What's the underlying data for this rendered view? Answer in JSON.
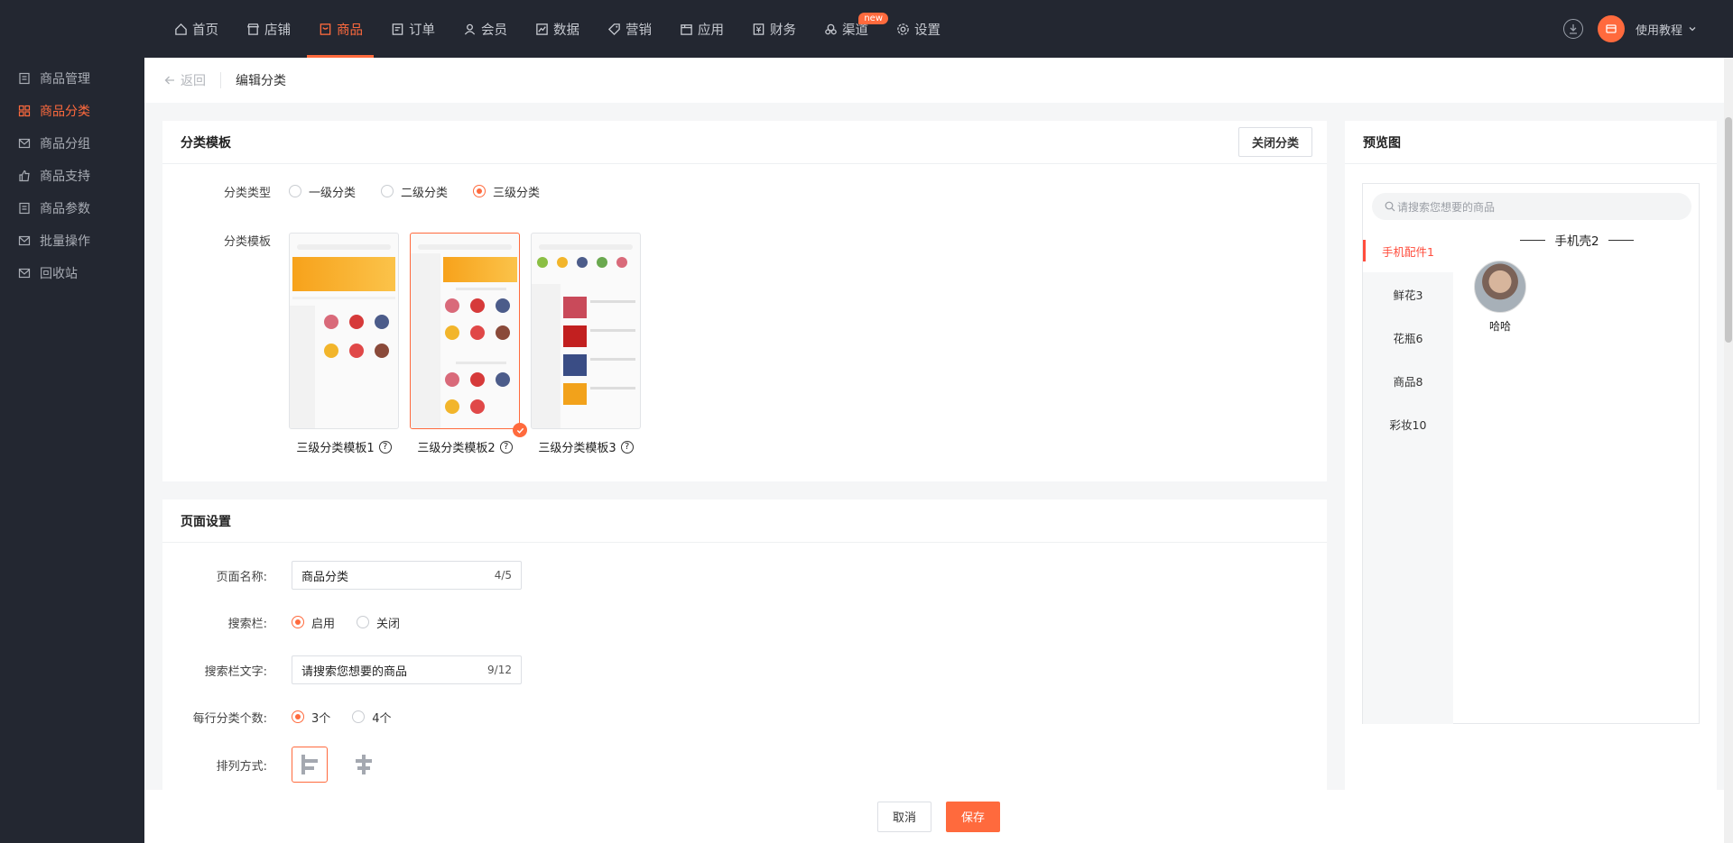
{
  "nav": {
    "items": [
      {
        "label": "首页",
        "icon": "home-icon"
      },
      {
        "label": "店铺",
        "icon": "store-icon"
      },
      {
        "label": "商品",
        "icon": "goods-icon",
        "active": true
      },
      {
        "label": "订单",
        "icon": "order-icon"
      },
      {
        "label": "会员",
        "icon": "member-icon"
      },
      {
        "label": "数据",
        "icon": "chart-icon"
      },
      {
        "label": "营销",
        "icon": "tag-icon"
      },
      {
        "label": "应用",
        "icon": "app-icon"
      },
      {
        "label": "财务",
        "icon": "finance-icon"
      },
      {
        "label": "渠道",
        "icon": "channel-icon",
        "badge": "new"
      },
      {
        "label": "设置",
        "icon": "gear-icon"
      }
    ],
    "help_label": "使用教程"
  },
  "sidebar": {
    "items": [
      {
        "label": "商品管理"
      },
      {
        "label": "商品分类",
        "active": true
      },
      {
        "label": "商品分组"
      },
      {
        "label": "商品支持"
      },
      {
        "label": "商品参数"
      },
      {
        "label": "批量操作"
      },
      {
        "label": "回收站"
      }
    ]
  },
  "breadcrumb": {
    "back": "返回",
    "title": "编辑分类"
  },
  "template_card": {
    "title": "分类模板",
    "close_button": "关闭分类",
    "type_label": "分类类型",
    "type_options": [
      "一级分类",
      "二级分类",
      "三级分类"
    ],
    "type_selected": 2,
    "template_label": "分类模板",
    "templates": [
      "三级分类模板1",
      "三级分类模板2",
      "三级分类模板3"
    ],
    "template_selected": 1
  },
  "page_card": {
    "title": "页面设置",
    "name_label": "页面名称:",
    "name_value": "商品分类",
    "name_count": "4/5",
    "search_label": "搜索栏:",
    "search_options": [
      "启用",
      "关闭"
    ],
    "search_text_label": "搜索栏文字:",
    "search_text_value": "请搜索您想要的商品",
    "search_text_count": "9/12",
    "per_row_label": "每行分类个数:",
    "per_row_options": [
      "3个",
      "4个"
    ],
    "arrange_label": "排列方式:"
  },
  "preview": {
    "title": "预览图",
    "search_placeholder": "请搜索您想要的商品",
    "categories": [
      "手机配件1",
      "鲜花3",
      "花瓶6",
      "商品8",
      "彩妆10"
    ],
    "sub_title": "手机壳2",
    "item_name": "哈哈"
  },
  "footer": {
    "cancel": "取消",
    "save": "保存"
  },
  "colors": {
    "accent": "#ff6a3d",
    "nav_bg": "#232731"
  }
}
